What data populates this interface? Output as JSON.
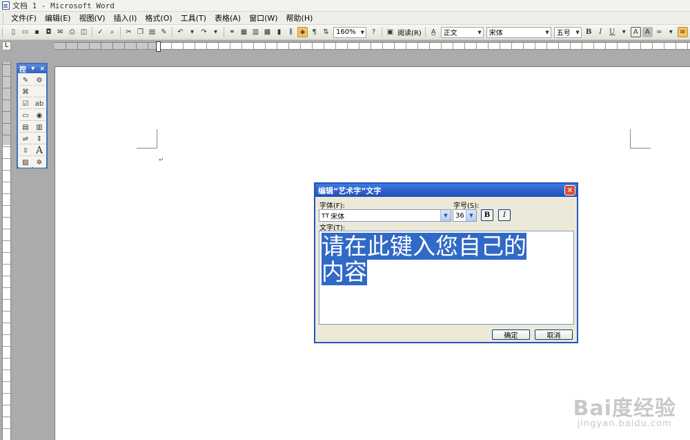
{
  "window": {
    "title": "文档 1 - Microsoft Word"
  },
  "menu": [
    "文件(F)",
    "编辑(E)",
    "视图(V)",
    "插入(I)",
    "格式(O)",
    "工具(T)",
    "表格(A)",
    "窗口(W)",
    "帮助(H)"
  ],
  "toolbar": {
    "zoom": "160%",
    "read_label": "阅读(R)",
    "style": "正文",
    "font": "宋体",
    "size": "五号",
    "bold": "B",
    "italic": "I",
    "underline": "U",
    "char_border": "A",
    "char_shade": "A"
  },
  "ruler": {
    "corner": "L"
  },
  "control_toolbar": {
    "title": "控",
    "close": "×",
    "text_button": "A"
  },
  "document": {
    "para_mark": "↵"
  },
  "dialog": {
    "title": "编辑“艺术字”文字",
    "font_label": "字体(F):",
    "font_value": "宋体",
    "size_label": "字号(S):",
    "size_value": "36",
    "bold_label": "B",
    "italic_label": "I",
    "text_label": "文字(T):",
    "text_line1": "请在此键入您自己的",
    "text_line2": "内容",
    "ok": "确定",
    "cancel": "取消"
  },
  "watermark": {
    "main": "Bai度经验",
    "sub": "jingyan.baidu.com"
  }
}
